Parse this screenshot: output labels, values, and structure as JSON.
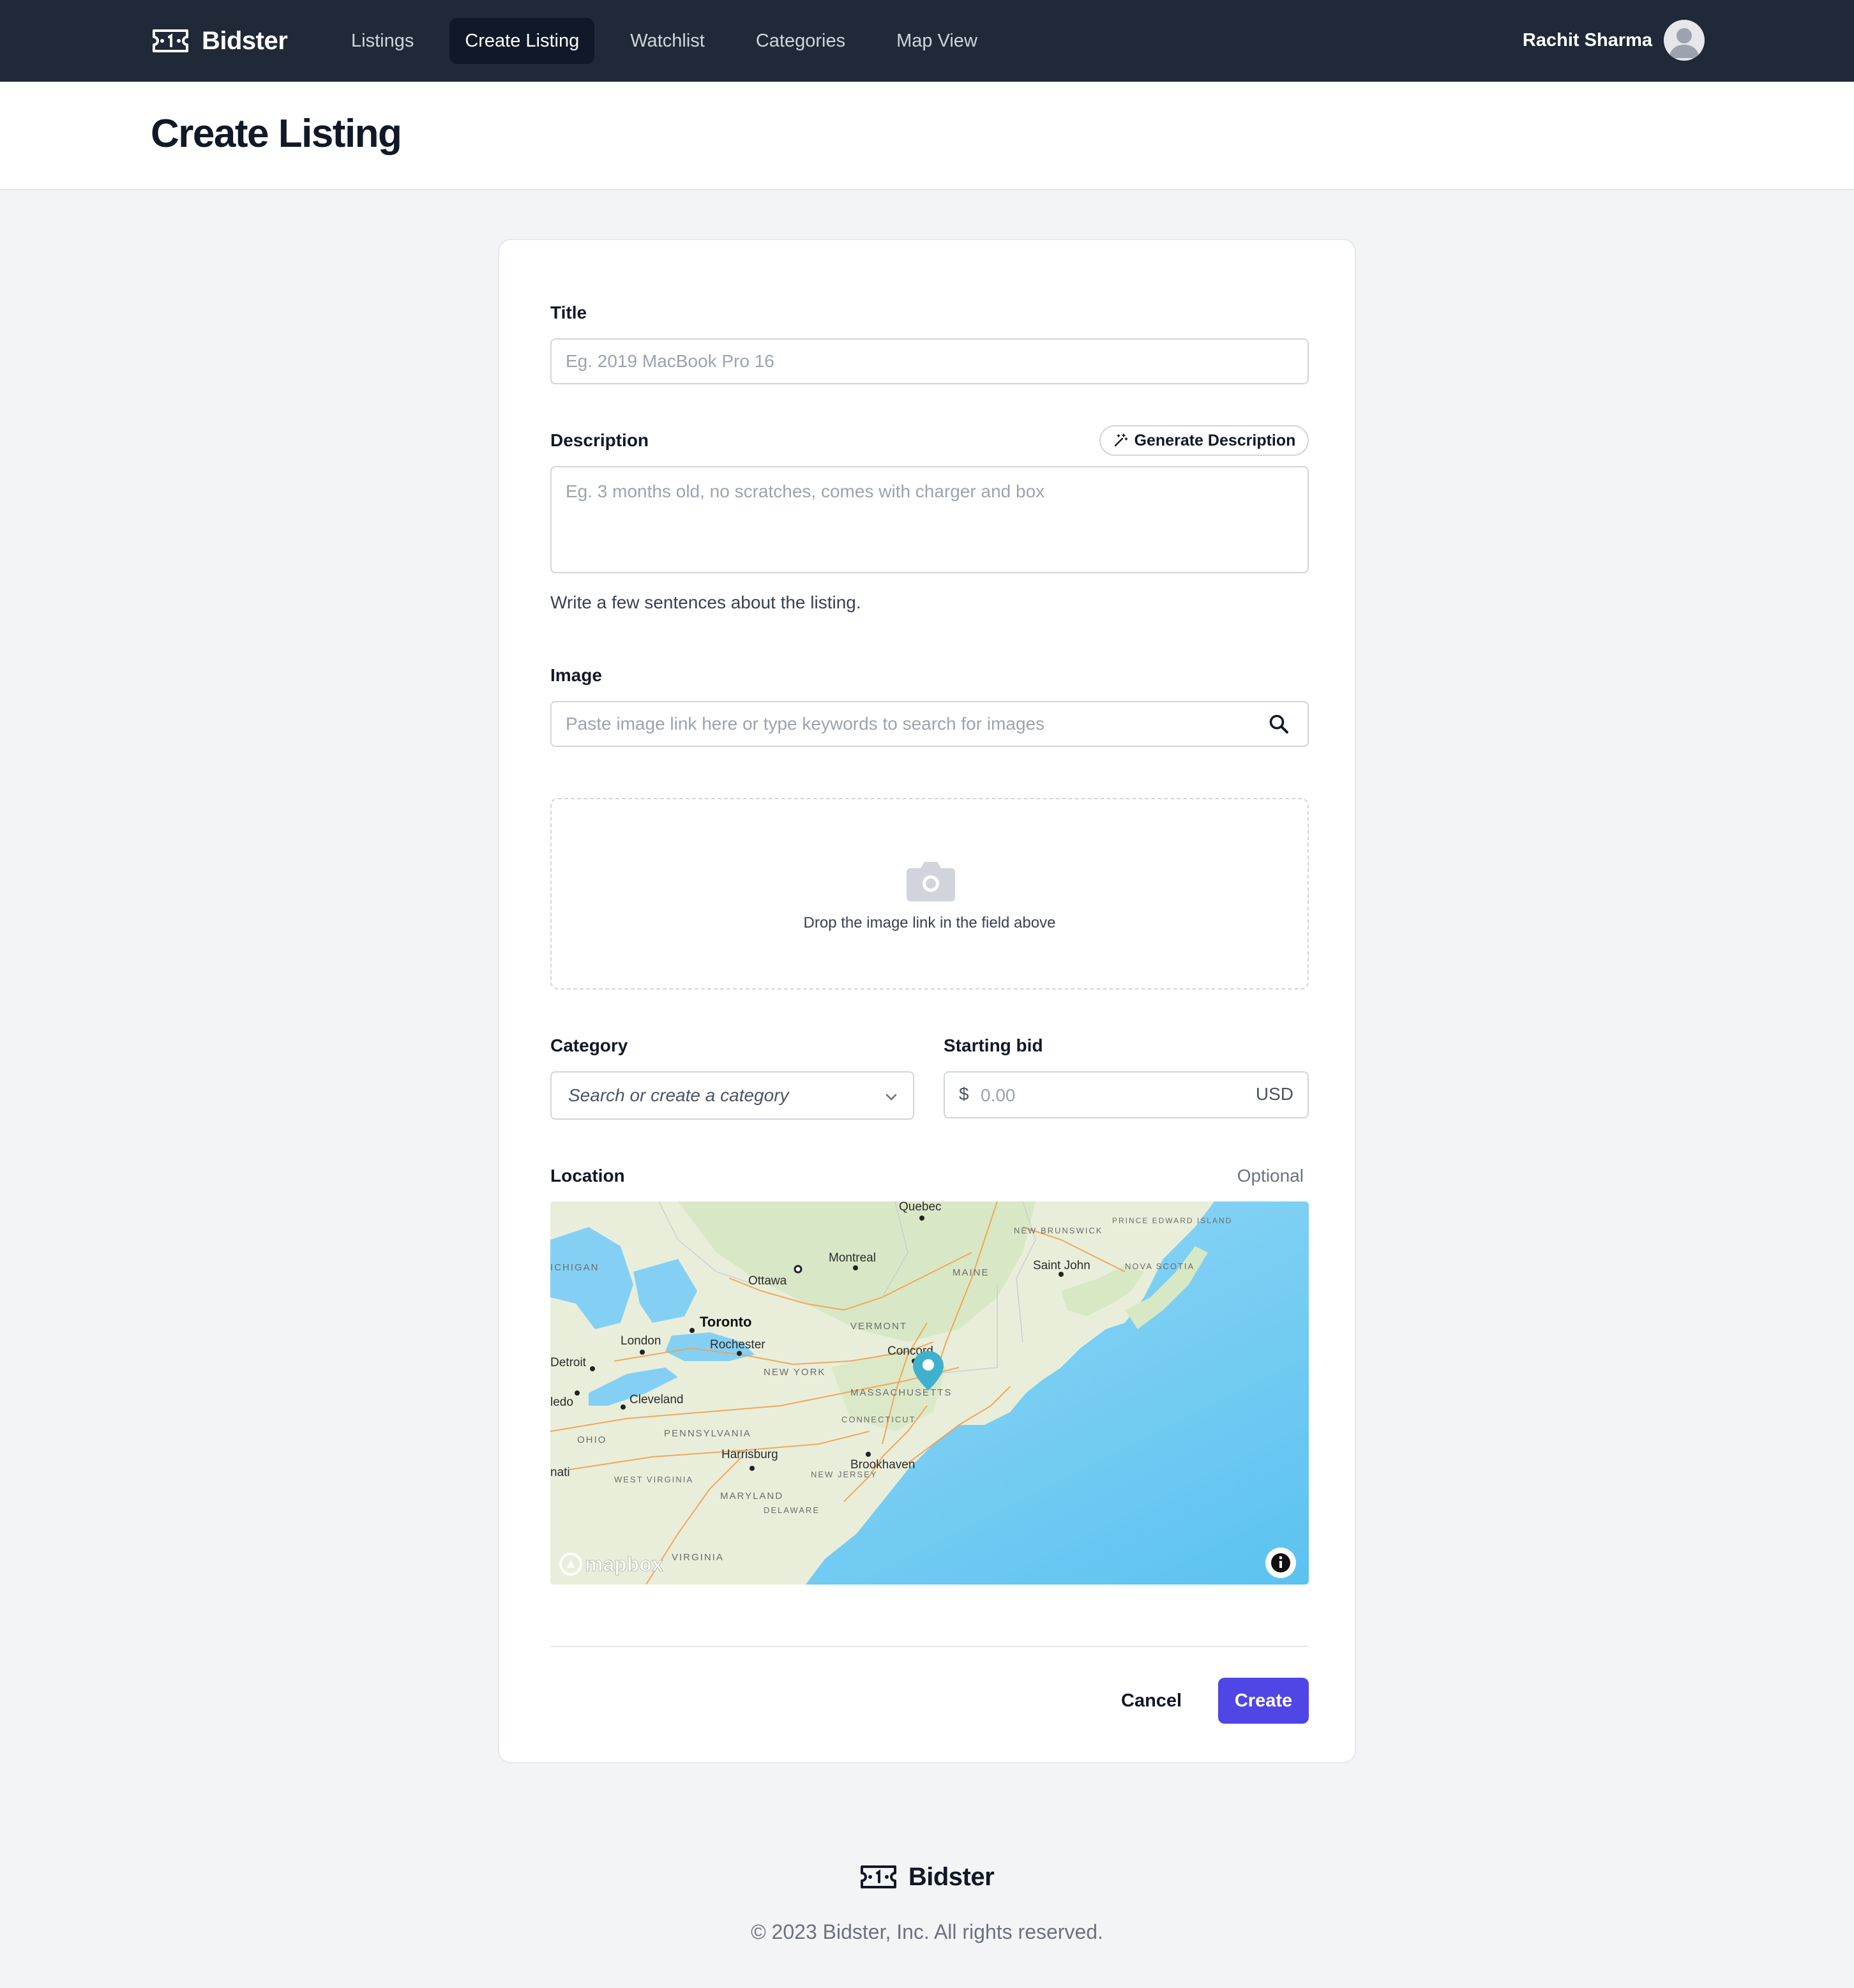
{
  "app": {
    "name": "Bidster"
  },
  "nav": {
    "items": [
      {
        "label": "Listings",
        "active": false
      },
      {
        "label": "Create Listing",
        "active": true
      },
      {
        "label": "Watchlist",
        "active": false
      },
      {
        "label": "Categories",
        "active": false
      },
      {
        "label": "Map View",
        "active": false
      }
    ]
  },
  "user": {
    "name": "Rachit Sharma"
  },
  "page": {
    "title": "Create Listing"
  },
  "form": {
    "title": {
      "label": "Title",
      "placeholder": "Eg. 2019 MacBook Pro 16",
      "value": ""
    },
    "description": {
      "label": "Description",
      "placeholder": "Eg. 3 months old, no scratches, comes with charger and box",
      "value": "",
      "help": "Write a few sentences about the listing.",
      "generate_label": "Generate Description"
    },
    "image": {
      "label": "Image",
      "placeholder": "Paste image link here or type keywords to search for images",
      "value": "",
      "drop_text": "Drop the image link in the field above"
    },
    "category": {
      "label": "Category",
      "placeholder": "Search or create a category"
    },
    "starting_bid": {
      "label": "Starting bid",
      "currency_symbol": "$",
      "placeholder": "0.00",
      "unit": "USD"
    },
    "location": {
      "label": "Location",
      "optional": "Optional",
      "attribution": "mapbox",
      "map_labels": {
        "quebec": "Quebec",
        "montreal": "Montreal",
        "ottawa": "Ottawa",
        "toronto": "Toronto",
        "london": "London",
        "rochester": "Rochester",
        "detroit": "Detroit",
        "toledo": "ledo",
        "cleveland": "Cleveland",
        "new_york": "NEW YORK",
        "vermont": "VERMONT",
        "concord": "Concord",
        "massachusetts": "MASSACHUSETTS",
        "connecticut": "CONNECTICUT",
        "brookhaven": "Brookhaven",
        "pennsylvania": "PENNSYLVANIA",
        "ohio": "OHIO",
        "harrisburg": "Harrisburg",
        "new_jersey": "NEW JERSEY",
        "west_virginia": "WEST VIRGINIA",
        "maryland": "MARYLAND",
        "delaware": "DELAWARE",
        "virginia": "VIRGINIA",
        "maine": "MAINE",
        "new_brunswick": "NEW BRUNSWICK",
        "saint_john": "Saint John",
        "prince_edward": "PRINCE EDWARD ISLAND",
        "nova_scotia": "NOVA SCOTIA",
        "michigan": "ICHIGAN",
        "cincinnati": "nati"
      }
    },
    "actions": {
      "cancel_label": "Cancel",
      "create_label": "Create"
    }
  },
  "footer": {
    "brand": "Bidster",
    "copyright": "© 2023 Bidster, Inc. All rights reserved."
  },
  "colors": {
    "nav_bg": "#1f2937",
    "primary": "#4f46e5",
    "page_bg": "#f3f4f6",
    "map_water": "#6cc8f2",
    "map_pin": "#3fb1ce"
  },
  "icons": {
    "logo": "ticket-icon",
    "avatar": "user-avatar-icon",
    "generate": "magic-wand-icon",
    "search": "search-icon",
    "camera": "camera-icon",
    "chevron": "chevron-down-icon",
    "pin": "map-pin-icon",
    "info": "info-icon"
  }
}
